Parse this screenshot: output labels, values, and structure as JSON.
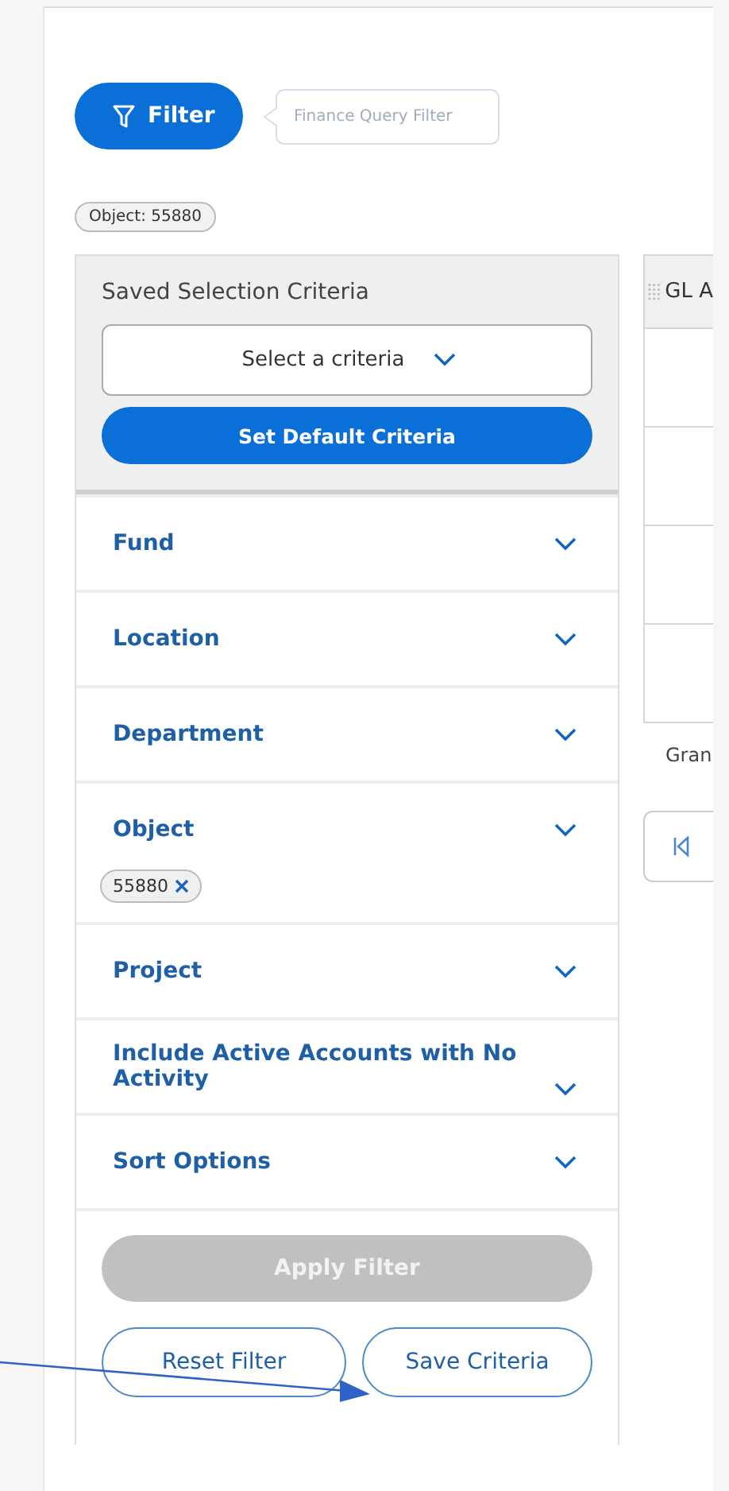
{
  "filter_button": {
    "label": "Filter"
  },
  "tooltip": {
    "text": "Finance Query Filter"
  },
  "active_chip": {
    "text": "Object: 55880"
  },
  "saved_criteria": {
    "title": "Saved Selection Criteria",
    "dropdown": {
      "value": "Select a criteria"
    },
    "default_button": {
      "label": "Set Default Criteria"
    }
  },
  "sections": [
    {
      "label": "Fund",
      "expanded": false
    },
    {
      "label": "Location",
      "expanded": false
    },
    {
      "label": "Department",
      "expanded": false
    },
    {
      "label": "Object",
      "expanded": false,
      "chips": [
        "55880"
      ]
    },
    {
      "label": "Project",
      "expanded": false
    },
    {
      "label": "Include Active Accounts with No Activity",
      "expanded": false
    },
    {
      "label": "Sort Options",
      "expanded": false
    }
  ],
  "apply_button": {
    "label": "Apply Filter",
    "disabled": true
  },
  "reset_button": {
    "label": "Reset Filter"
  },
  "save_button": {
    "label": "Save Criteria"
  },
  "table": {
    "column_1": "GL A",
    "footer": "Gran"
  }
}
